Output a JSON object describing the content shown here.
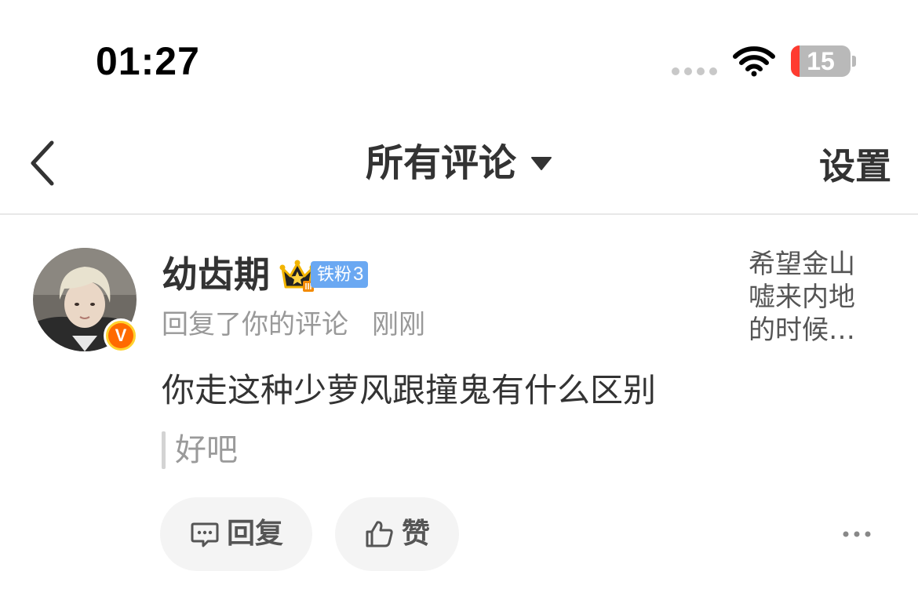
{
  "status_bar": {
    "time": "01:27",
    "battery": "15",
    "battery_level": 0.15
  },
  "nav": {
    "back_icon": "chevron-left-icon",
    "title": "所有评论",
    "dropdown_icon": "caret-down-icon",
    "settings_label": "设置"
  },
  "comment": {
    "username": "幼齿期",
    "crown_icon": "crown-icon",
    "fan_badge": {
      "label": "铁粉",
      "level": "3",
      "color": "#6aa8f2"
    },
    "vip_label": "V",
    "action_text": "回复了你的评论",
    "timestamp": "刚刚",
    "text": "你走这种少萝风跟撞鬼有什么区别",
    "quoted_text": "好吧",
    "preview_text": "希望金山嘘来内地的时候…",
    "buttons": {
      "reply_label": "回复",
      "reply_icon": "comment-icon",
      "like_label": "赞",
      "like_icon": "thumbs-up-icon",
      "more_icon": "more-dots-icon"
    }
  }
}
